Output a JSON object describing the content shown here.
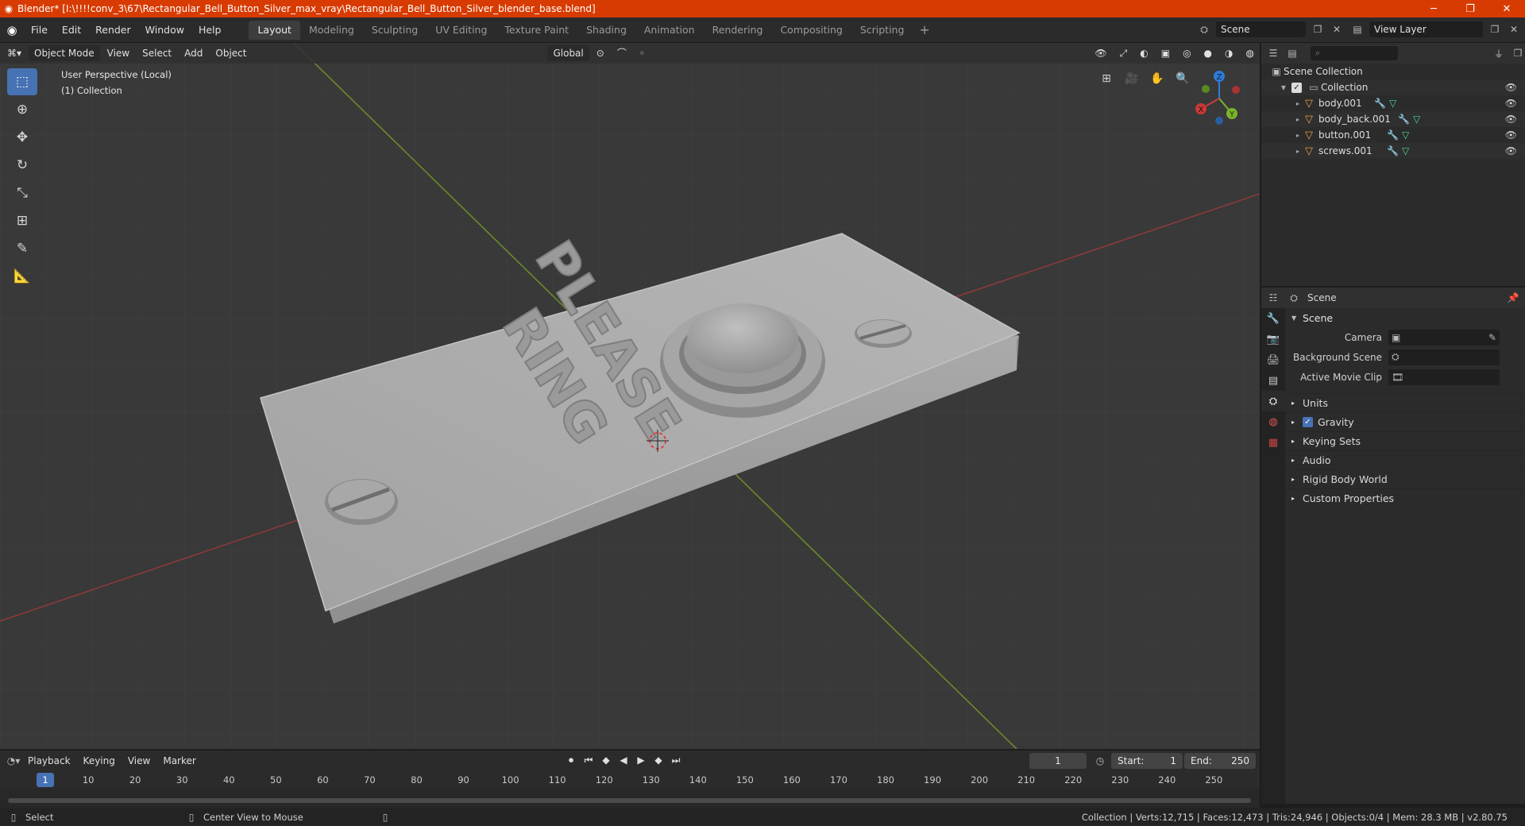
{
  "window": {
    "title": "Blender* [I:\\!!!!conv_3\\67\\Rectangular_Bell_Button_Silver_max_vray\\Rectangular_Bell_Button_Silver_blender_base.blend]",
    "minimize": "─",
    "maximize": "❐",
    "close": "✕"
  },
  "menu": [
    "File",
    "Edit",
    "Render",
    "Window",
    "Help"
  ],
  "workspaces": [
    "Layout",
    "Modeling",
    "Sculpting",
    "UV Editing",
    "Texture Paint",
    "Shading",
    "Animation",
    "Rendering",
    "Compositing",
    "Scripting"
  ],
  "scene_selector": {
    "value": "Scene"
  },
  "view_layer": {
    "value": "View Layer"
  },
  "viewport": {
    "mode": "Object Mode",
    "menus": [
      "View",
      "Select",
      "Add",
      "Object"
    ],
    "orientation": "Global",
    "info_line1": "User Perspective (Local)",
    "info_line2": "(1) Collection",
    "plate_text_line1": "PLEASE",
    "plate_text_line2": "RING",
    "gizmo_labels": {
      "x": "X",
      "y": "Y",
      "z": "Z"
    }
  },
  "outliner": {
    "root": "Scene Collection",
    "collection": "Collection",
    "objects": [
      "body.001",
      "body_back.001",
      "button.001",
      "screws.001"
    ]
  },
  "properties": {
    "header": "Scene",
    "panel_title": "Scene",
    "fields": [
      {
        "label": "Camera"
      },
      {
        "label": "Background Scene"
      },
      {
        "label": "Active Movie Clip"
      }
    ],
    "subpanels": [
      "Units",
      "Gravity",
      "Keying Sets",
      "Audio",
      "Rigid Body World",
      "Custom Properties"
    ],
    "gravity_checked": true
  },
  "timeline": {
    "menus": [
      "Playback",
      "Keying",
      "View",
      "Marker"
    ],
    "current_frame": "1",
    "start_label": "Start:",
    "start": "1",
    "end_label": "End:",
    "end": "250",
    "ruler": [
      "10",
      "20",
      "30",
      "40",
      "50",
      "60",
      "70",
      "80",
      "90",
      "100",
      "110",
      "120",
      "130",
      "140",
      "150",
      "160",
      "170",
      "180",
      "190",
      "200",
      "210",
      "220",
      "230",
      "240",
      "250"
    ],
    "ruler_current": "1"
  },
  "statusbar": {
    "left_action": "Select",
    "middle_action": "Center View to Mouse",
    "stats": "Collection | Verts:12,715 | Faces:12,473 | Tris:24,946 | Objects:0/4 | Mem: 28.3 MB | v2.80.75"
  }
}
